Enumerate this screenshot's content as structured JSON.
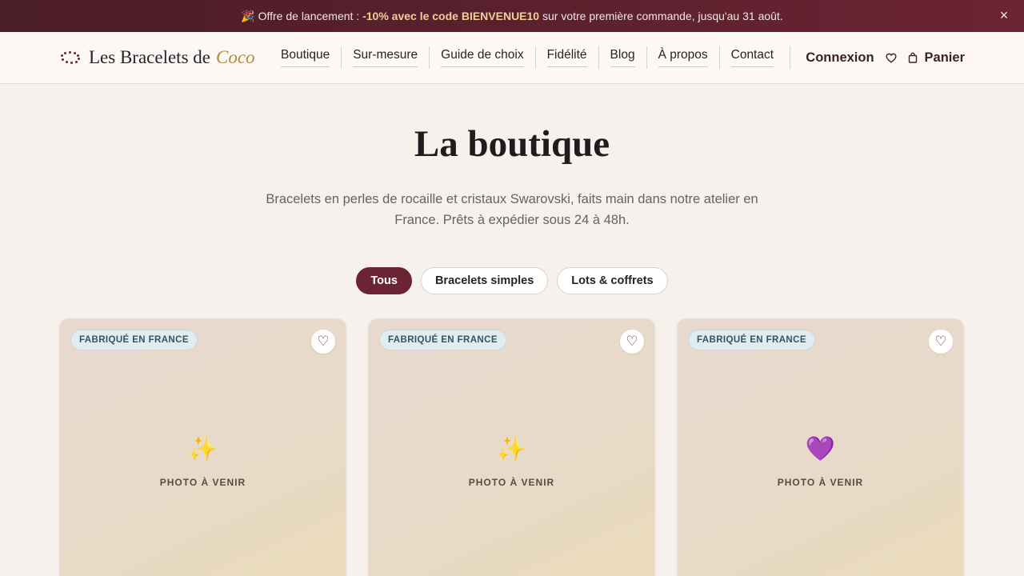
{
  "promo": {
    "prefix": "🎉 Offre de lancement : ",
    "highlight": "-10% avec le code BIENVENUE10",
    "suffix": " sur votre première commande, jusqu'au 31 août.",
    "close": "×"
  },
  "brand": {
    "name": "Les Bracelets de",
    "accent": "Coco"
  },
  "nav": {
    "items": [
      {
        "label": "Boutique"
      },
      {
        "label": "Sur-mesure"
      },
      {
        "label": "Guide de choix"
      },
      {
        "label": "Fidélité"
      },
      {
        "label": "Blog"
      },
      {
        "label": "À propos"
      },
      {
        "label": "Contact"
      }
    ],
    "login": "Connexion",
    "cart": "Panier"
  },
  "hero": {
    "title": "La boutique",
    "subtitle": "Bracelets en perles de rocaille et cristaux Swarovski, faits main dans notre atelier en France. Prêts à expédier sous 24 à 48h."
  },
  "filters": [
    {
      "label": "Tous",
      "active": true
    },
    {
      "label": "Bracelets simples",
      "active": false
    },
    {
      "label": "Lots & coffrets",
      "active": false
    }
  ],
  "products": [
    {
      "badge": "FABRIQUÉ EN FRANCE",
      "icon": "✨",
      "placeholder": "PHOTO À VENIR",
      "fav": "♡"
    },
    {
      "badge": "FABRIQUÉ EN FRANCE",
      "icon": "✨",
      "placeholder": "PHOTO À VENIR",
      "fav": "♡"
    },
    {
      "badge": "FABRIQUÉ EN FRANCE",
      "icon": "💜",
      "placeholder": "PHOTO À VENIR",
      "fav": "♡"
    }
  ],
  "colors": {
    "accent": "#6b2434",
    "gold": "#b08a3b",
    "promo_bg": "#4a1d27"
  }
}
